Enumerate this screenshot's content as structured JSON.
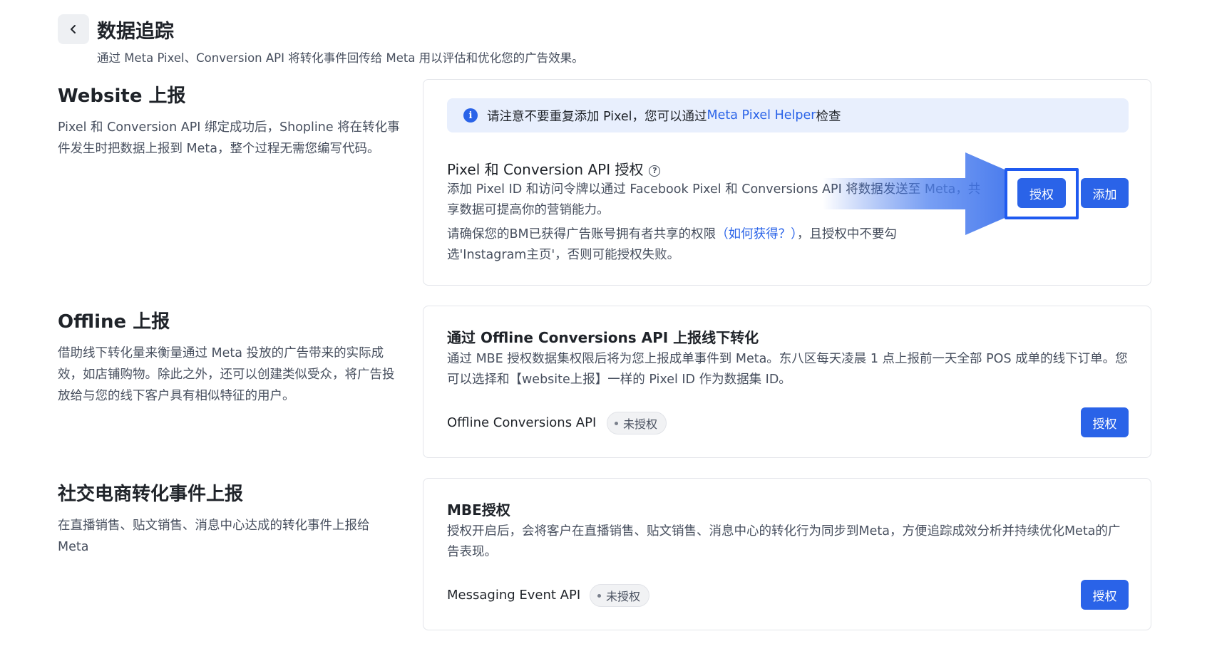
{
  "header": {
    "back_icon": "chevron-left-icon",
    "title": "数据追踪",
    "subtitle": "通过 Meta Pixel、Conversion API 将转化事件回传给 Meta 用以评估和优化您的广告效果。"
  },
  "sections": {
    "website": {
      "title": "Website 上报",
      "description": "Pixel 和 Conversion API 绑定成功后，Shopline 将在转化事件发生时把数据上报到 Meta，整个过程无需您编写代码。"
    },
    "offline": {
      "title": "Offline 上报",
      "description": "借助线下转化量来衡量通过 Meta 投放的广告带来的实际成效，如店铺购物。除此之外，还可以创建类似受众，将广告投放给与您的线下客户具有相似特征的用户。"
    },
    "social": {
      "title": "社交电商转化事件上报",
      "description": "在直播销售、贴文销售、消息中心达成的转化事件上报给 Meta"
    }
  },
  "website_card": {
    "notice_prefix": "请注意不要重复添加 Pixel，您可以通过 ",
    "notice_link": "Meta Pixel Helper",
    "notice_suffix": " 检查",
    "title": "Pixel 和 Conversion API 授权",
    "description": "添加 Pixel ID 和访问令牌以通过 Facebook Pixel 和 Conversions API 将数据发送至 Meta，共享数据可提高你的营销能力。",
    "note_prefix": "请确保您的BM已获得广告账号拥有者共享的权限",
    "note_link": "（如何获得？）",
    "note_suffix": "，且授权中不要勾选'Instagram主页'，否则可能授权失败。",
    "authorize_label": "授权",
    "add_label": "添加"
  },
  "offline_card": {
    "title": "通过 Offline Conversions API 上报线下转化",
    "description": "通过 MBE 授权数据集权限后将为您上报成单事件到 Meta。东八区每天凌晨 1 点上报前一天全部 POS 成单的线下订单。您可以选择和【website上报】一样的 Pixel ID 作为数据集 ID。",
    "api_label": "Offline Conversions API",
    "status": "未授权",
    "authorize_label": "授权"
  },
  "mbe_card": {
    "title": "MBE授权",
    "description": "授权开启后，会将客户在直播销售、贴文销售、消息中心的转化行为同步到Meta，方便追踪成效分析并持续优化Meta的广告表现。",
    "api_label": "Messaging Event API",
    "status": "未授权",
    "authorize_label": "授权"
  },
  "colors": {
    "primary": "#2a63e8",
    "notice_bg": "#e8effd",
    "highlight": "#1f5af0"
  }
}
